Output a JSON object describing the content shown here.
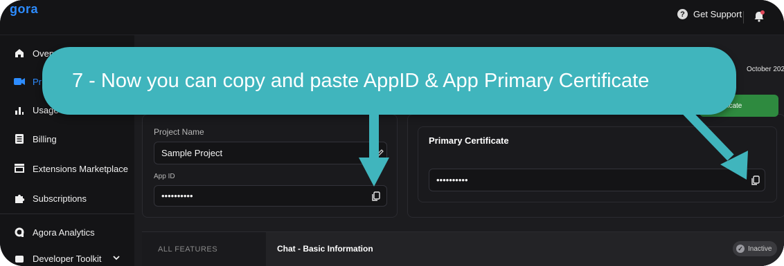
{
  "header": {
    "logo_text": "gora",
    "support_label": "Get Support",
    "help_icon": "?"
  },
  "sidebar": {
    "items": [
      {
        "label": "Overvi",
        "icon": "home-icon"
      },
      {
        "label": "Pr",
        "icon": "video-icon",
        "active": true
      },
      {
        "label": "Usage",
        "icon": "bar-chart-icon"
      },
      {
        "label": "Billing",
        "icon": "document-icon"
      },
      {
        "label": "Extensions Marketplace",
        "icon": "store-icon"
      },
      {
        "label": "Subscriptions",
        "icon": "puzzle-icon"
      },
      {
        "label": "Agora Analytics",
        "icon": "agora-icon"
      },
      {
        "label": "Developer Toolkit",
        "icon": "toolkit-icon"
      }
    ]
  },
  "project": {
    "name_label": "Project Name",
    "name_value": "Sample Project",
    "appid_label": "App ID",
    "appid_value": "••••••••••"
  },
  "certificate": {
    "title": "Primary Certificate",
    "value": "••••••••••",
    "action_label": "a Certificate",
    "date_partial": "October 202"
  },
  "features": {
    "all_label": "ALL FEATURES",
    "chat_title": "Chat - Basic Information",
    "status": "Inactive"
  },
  "annotation": {
    "text": "7 - Now you can copy and paste AppID & App Primary Certificate"
  },
  "colors": {
    "accent": "#2d8cff",
    "banner": "#40b5bd",
    "green": "#2e8a3f",
    "background": "#141416"
  }
}
